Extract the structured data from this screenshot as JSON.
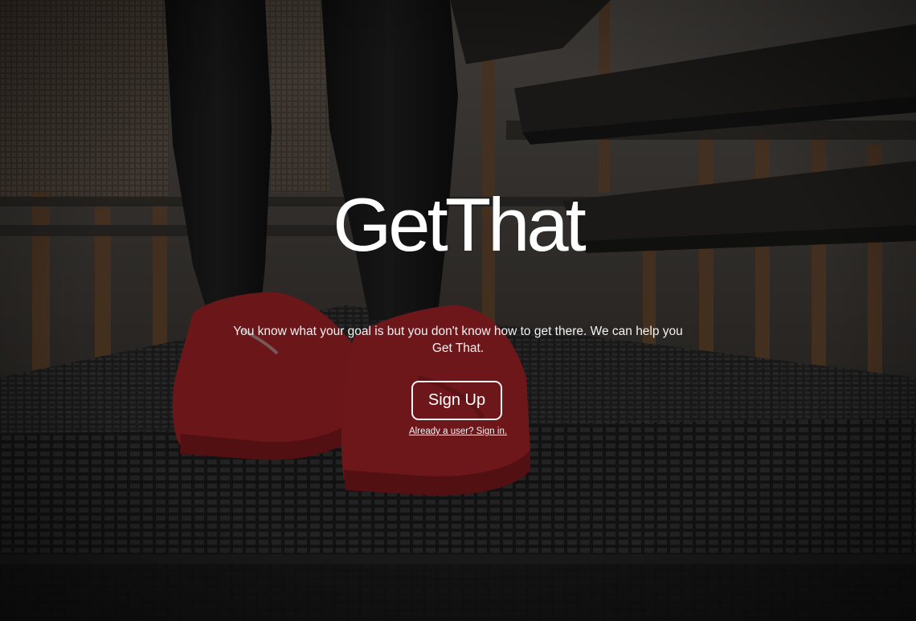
{
  "hero": {
    "title": "GetThat",
    "tagline": "You know what your goal is but you don't know how to get there. We can help you Get That.",
    "signup_label": "Sign Up",
    "signin_label": "Already a user? Sign in.",
    "background_image": "photo of red sneakers standing on a metal grate staircase, dark overlay"
  },
  "colors": {
    "text": "#ffffff",
    "button_border": "#f4f4f4",
    "accent_shoe": "#b8262c",
    "overlay": "#000000"
  }
}
